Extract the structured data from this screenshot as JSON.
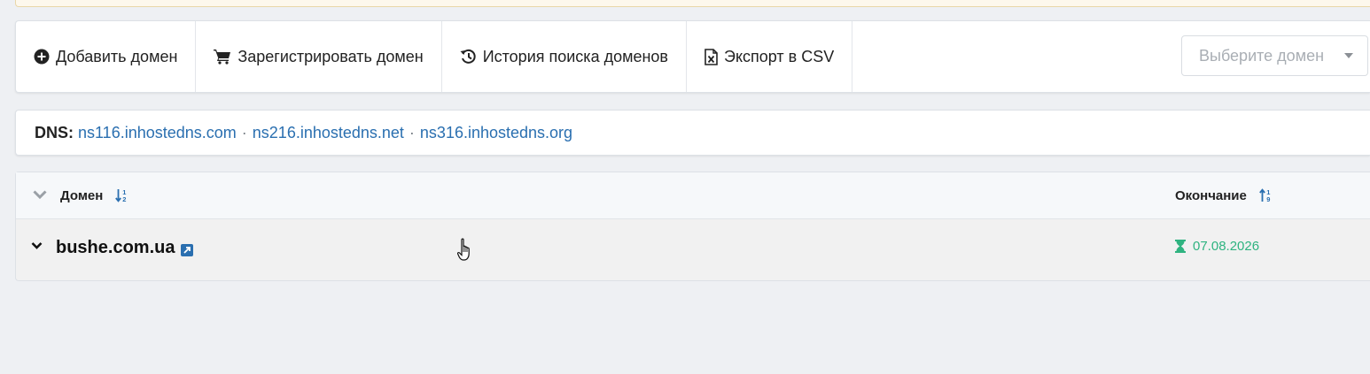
{
  "toolbar": {
    "add_domain": "Добавить домен",
    "register_domain": "Зарегистрировать домен",
    "search_history": "История поиска доменов",
    "export_csv": "Экспорт в CSV",
    "domain_select_placeholder": "Выберите домен"
  },
  "dns": {
    "label": "DNS:",
    "servers": [
      "ns116.inhostedns.com",
      "ns216.inhostedns.net",
      "ns316.inhostedns.org"
    ],
    "separator": "·"
  },
  "table": {
    "columns": {
      "domain": "Домен",
      "expiry": "Окончание"
    },
    "rows": [
      {
        "domain": "bushe.com.ua",
        "expiry": "07.08.2026"
      }
    ]
  },
  "icons": {
    "add": "plus-circle-icon",
    "cart": "cart-icon",
    "history": "history-icon",
    "export": "file-excel-icon",
    "sort_alpha": "sort-alpha-icon",
    "sort_numeric": "sort-numeric-icon",
    "external": "external-link-icon",
    "hourglass": "hourglass-icon"
  },
  "colors": {
    "link": "#2a6fb0",
    "expiry_ok": "#2fb380",
    "sort_icon": "#2a6fb0"
  }
}
